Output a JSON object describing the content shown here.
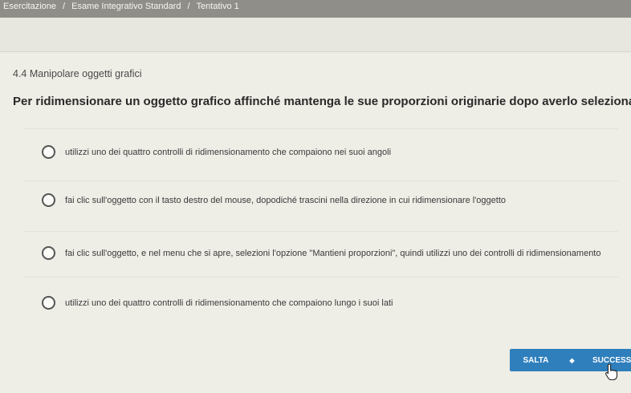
{
  "breadcrumb": {
    "items": [
      "Esercitazione",
      "Esame Integrativo Standard",
      "Tentativo 1"
    ],
    "separator": "/"
  },
  "section": {
    "title": "4.4 Manipolare oggetti grafici"
  },
  "question": {
    "text": "Per ridimensionare un oggetto grafico affinché mantenga le sue proporzioni originarie dopo averlo selezionato:",
    "options": [
      "utilizzi uno dei quattro controlli di ridimensionamento che compaiono nei suoi angoli",
      "fai clic sull'oggetto con il tasto destro del mouse, dopodiché trascini nella direzione in cui ridimensionare l'oggetto",
      "fai clic sull'oggetto, e nel menu che si apre, selezioni l'opzione \"Mantieni proporzioni\", quindi utilizzi uno dei controlli di ridimensionamento",
      "utilizzi uno dei quattro controlli di ridimensionamento che compaiono lungo i suoi lati"
    ]
  },
  "buttons": {
    "skip": "SALTA",
    "next": "SUCCESSIVO"
  },
  "icons": {
    "skip_arrow": "arrow-right-icon",
    "cursor": "hand-pointer-icon"
  },
  "colors": {
    "accent": "#2f7fbd",
    "topbar": "#8f8e88",
    "background": "#eeede6"
  }
}
